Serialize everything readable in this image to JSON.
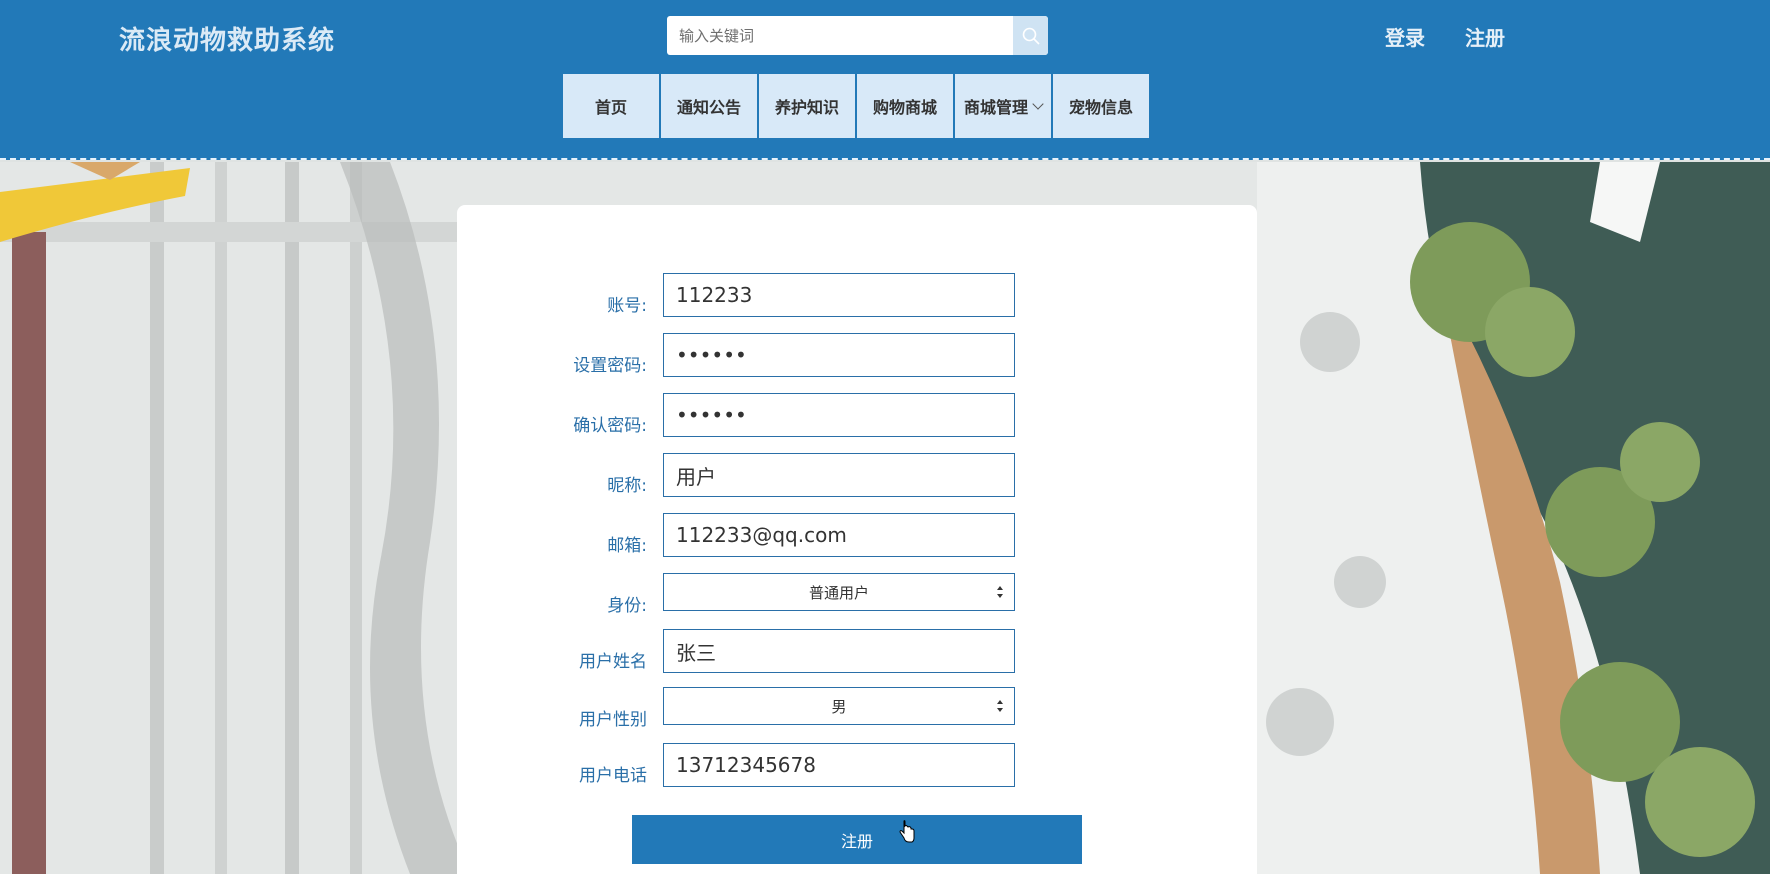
{
  "brand": {
    "title": "流浪动物救助系统"
  },
  "search": {
    "placeholder": "输入关键词"
  },
  "auth": {
    "login": "登录",
    "register": "注册"
  },
  "nav": [
    {
      "label": "首页"
    },
    {
      "label": "通知公告"
    },
    {
      "label": "养护知识"
    },
    {
      "label": "购物商城"
    },
    {
      "label": "商城管理"
    },
    {
      "label": "宠物信息"
    }
  ],
  "form": {
    "account": {
      "label": "账号:",
      "value": "112233"
    },
    "password": {
      "label": "设置密码:",
      "value": "••••••"
    },
    "confirm": {
      "label": "确认密码:",
      "value": "••••••"
    },
    "nickname": {
      "label": "昵称:",
      "value": "用户"
    },
    "email": {
      "label": "邮箱:",
      "value": "112233@qq.com"
    },
    "identity": {
      "label": "身份:",
      "value": "普通用户"
    },
    "name": {
      "label": "用户姓名",
      "value": "张三"
    },
    "gender": {
      "label": "用户性别",
      "value": "男"
    },
    "phone": {
      "label": "用户电话",
      "value": "13712345678"
    },
    "submit": "注册"
  },
  "colors": {
    "primary": "#2279b8",
    "nav_bg": "#d8e9f8",
    "label": "#2a6fa8"
  }
}
